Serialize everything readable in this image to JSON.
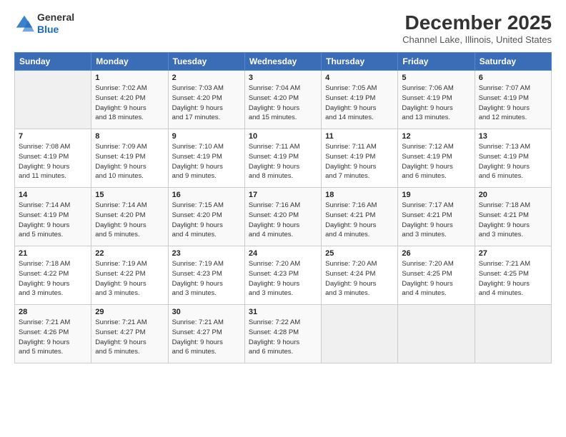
{
  "logo": {
    "line1": "General",
    "line2": "Blue"
  },
  "title": "December 2025",
  "subtitle": "Channel Lake, Illinois, United States",
  "headers": [
    "Sunday",
    "Monday",
    "Tuesday",
    "Wednesday",
    "Thursday",
    "Friday",
    "Saturday"
  ],
  "weeks": [
    [
      {
        "num": "",
        "detail": ""
      },
      {
        "num": "1",
        "detail": "Sunrise: 7:02 AM\nSunset: 4:20 PM\nDaylight: 9 hours\nand 18 minutes."
      },
      {
        "num": "2",
        "detail": "Sunrise: 7:03 AM\nSunset: 4:20 PM\nDaylight: 9 hours\nand 17 minutes."
      },
      {
        "num": "3",
        "detail": "Sunrise: 7:04 AM\nSunset: 4:20 PM\nDaylight: 9 hours\nand 15 minutes."
      },
      {
        "num": "4",
        "detail": "Sunrise: 7:05 AM\nSunset: 4:19 PM\nDaylight: 9 hours\nand 14 minutes."
      },
      {
        "num": "5",
        "detail": "Sunrise: 7:06 AM\nSunset: 4:19 PM\nDaylight: 9 hours\nand 13 minutes."
      },
      {
        "num": "6",
        "detail": "Sunrise: 7:07 AM\nSunset: 4:19 PM\nDaylight: 9 hours\nand 12 minutes."
      }
    ],
    [
      {
        "num": "7",
        "detail": "Sunrise: 7:08 AM\nSunset: 4:19 PM\nDaylight: 9 hours\nand 11 minutes."
      },
      {
        "num": "8",
        "detail": "Sunrise: 7:09 AM\nSunset: 4:19 PM\nDaylight: 9 hours\nand 10 minutes."
      },
      {
        "num": "9",
        "detail": "Sunrise: 7:10 AM\nSunset: 4:19 PM\nDaylight: 9 hours\nand 9 minutes."
      },
      {
        "num": "10",
        "detail": "Sunrise: 7:11 AM\nSunset: 4:19 PM\nDaylight: 9 hours\nand 8 minutes."
      },
      {
        "num": "11",
        "detail": "Sunrise: 7:11 AM\nSunset: 4:19 PM\nDaylight: 9 hours\nand 7 minutes."
      },
      {
        "num": "12",
        "detail": "Sunrise: 7:12 AM\nSunset: 4:19 PM\nDaylight: 9 hours\nand 6 minutes."
      },
      {
        "num": "13",
        "detail": "Sunrise: 7:13 AM\nSunset: 4:19 PM\nDaylight: 9 hours\nand 6 minutes."
      }
    ],
    [
      {
        "num": "14",
        "detail": "Sunrise: 7:14 AM\nSunset: 4:19 PM\nDaylight: 9 hours\nand 5 minutes."
      },
      {
        "num": "15",
        "detail": "Sunrise: 7:14 AM\nSunset: 4:20 PM\nDaylight: 9 hours\nand 5 minutes."
      },
      {
        "num": "16",
        "detail": "Sunrise: 7:15 AM\nSunset: 4:20 PM\nDaylight: 9 hours\nand 4 minutes."
      },
      {
        "num": "17",
        "detail": "Sunrise: 7:16 AM\nSunset: 4:20 PM\nDaylight: 9 hours\nand 4 minutes."
      },
      {
        "num": "18",
        "detail": "Sunrise: 7:16 AM\nSunset: 4:21 PM\nDaylight: 9 hours\nand 4 minutes."
      },
      {
        "num": "19",
        "detail": "Sunrise: 7:17 AM\nSunset: 4:21 PM\nDaylight: 9 hours\nand 3 minutes."
      },
      {
        "num": "20",
        "detail": "Sunrise: 7:18 AM\nSunset: 4:21 PM\nDaylight: 9 hours\nand 3 minutes."
      }
    ],
    [
      {
        "num": "21",
        "detail": "Sunrise: 7:18 AM\nSunset: 4:22 PM\nDaylight: 9 hours\nand 3 minutes."
      },
      {
        "num": "22",
        "detail": "Sunrise: 7:19 AM\nSunset: 4:22 PM\nDaylight: 9 hours\nand 3 minutes."
      },
      {
        "num": "23",
        "detail": "Sunrise: 7:19 AM\nSunset: 4:23 PM\nDaylight: 9 hours\nand 3 minutes."
      },
      {
        "num": "24",
        "detail": "Sunrise: 7:20 AM\nSunset: 4:23 PM\nDaylight: 9 hours\nand 3 minutes."
      },
      {
        "num": "25",
        "detail": "Sunrise: 7:20 AM\nSunset: 4:24 PM\nDaylight: 9 hours\nand 3 minutes."
      },
      {
        "num": "26",
        "detail": "Sunrise: 7:20 AM\nSunset: 4:25 PM\nDaylight: 9 hours\nand 4 minutes."
      },
      {
        "num": "27",
        "detail": "Sunrise: 7:21 AM\nSunset: 4:25 PM\nDaylight: 9 hours\nand 4 minutes."
      }
    ],
    [
      {
        "num": "28",
        "detail": "Sunrise: 7:21 AM\nSunset: 4:26 PM\nDaylight: 9 hours\nand 5 minutes."
      },
      {
        "num": "29",
        "detail": "Sunrise: 7:21 AM\nSunset: 4:27 PM\nDaylight: 9 hours\nand 5 minutes."
      },
      {
        "num": "30",
        "detail": "Sunrise: 7:21 AM\nSunset: 4:27 PM\nDaylight: 9 hours\nand 6 minutes."
      },
      {
        "num": "31",
        "detail": "Sunrise: 7:22 AM\nSunset: 4:28 PM\nDaylight: 9 hours\nand 6 minutes."
      },
      {
        "num": "",
        "detail": ""
      },
      {
        "num": "",
        "detail": ""
      },
      {
        "num": "",
        "detail": ""
      }
    ]
  ]
}
